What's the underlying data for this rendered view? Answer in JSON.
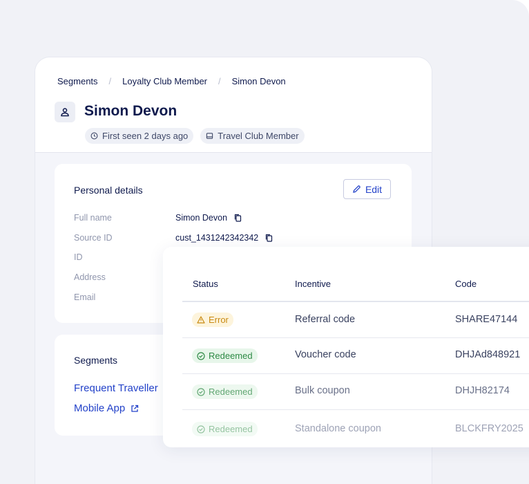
{
  "breadcrumb": [
    "Segments",
    "Loyalty Club Member",
    "Simon Devon"
  ],
  "customer": {
    "name": "Simon Devon",
    "first_seen": "First seen 2 days ago",
    "segment_chip": "Travel Club Member"
  },
  "personal": {
    "title": "Personal details",
    "edit_label": "Edit",
    "fields": [
      {
        "label": "Full name",
        "value": "Simon Devon"
      },
      {
        "label": "Source ID",
        "value": "cust_1431242342342"
      },
      {
        "label": "ID",
        "value": ""
      },
      {
        "label": "Address",
        "value": ""
      },
      {
        "label": "Email",
        "value": ""
      }
    ]
  },
  "segments": {
    "title": "Segments",
    "items": [
      "Frequent Traveller",
      "Mobile App"
    ]
  },
  "table": {
    "headers": [
      "Status",
      "Incentive",
      "Code"
    ],
    "rows": [
      {
        "status": "Error",
        "incentive": "Referral code",
        "code": "SHARE47144"
      },
      {
        "status": "Redeemed",
        "incentive": "Voucher code",
        "code": "DHJAd848921"
      },
      {
        "status": "Redeemed",
        "incentive": "Bulk coupon",
        "code": "DHJH82174"
      },
      {
        "status": "Redeemed",
        "incentive": "Standalone coupon",
        "code": "BLCKFRY2025"
      }
    ]
  },
  "colors": {
    "accent": "#2342c9",
    "error": "#c98a12",
    "success": "#2e8a45"
  }
}
